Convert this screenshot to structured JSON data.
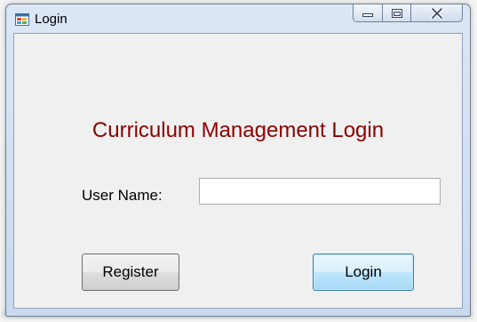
{
  "window": {
    "title": "Login",
    "icon": "windows-form-icon",
    "caption_buttons": [
      "minimize-icon",
      "maximize-icon",
      "close-icon"
    ]
  },
  "form": {
    "heading": "Curriculum Management Login",
    "username_label": "User Name:",
    "username_value": "",
    "register_label": "Register",
    "login_label": "Login"
  },
  "colors": {
    "heading": "#8b0000",
    "client_bg": "#f0f0f0",
    "default_button_border": "#3c7fb1"
  }
}
